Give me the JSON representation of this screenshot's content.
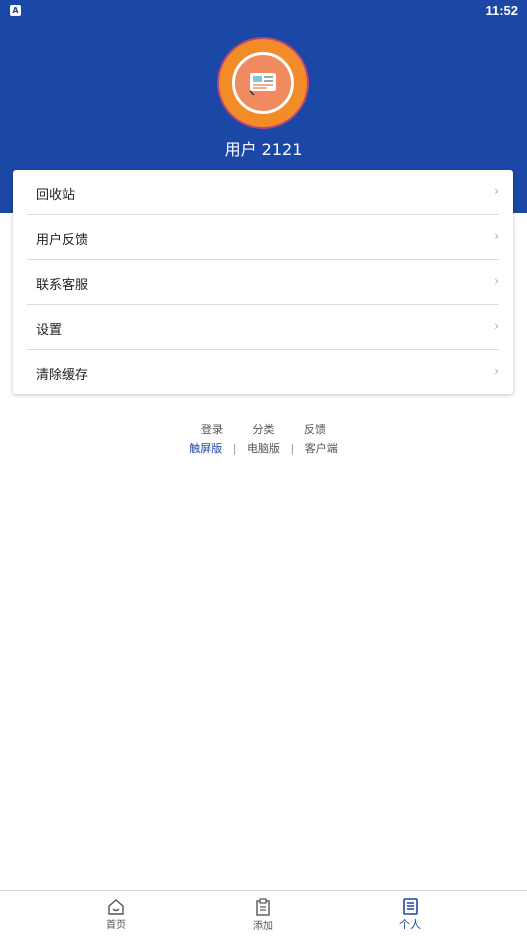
{
  "status_bar": {
    "app_icon_letter": "A",
    "time": "11:52"
  },
  "profile": {
    "username": "用户 2121"
  },
  "menu": {
    "items": [
      {
        "label": "回收站"
      },
      {
        "label": "用户反馈"
      },
      {
        "label": "联系客服"
      },
      {
        "label": "设置"
      },
      {
        "label": "清除缓存"
      }
    ],
    "chevron": "›"
  },
  "footer": {
    "links": [
      "登录",
      "分类",
      "反馈"
    ],
    "modes": [
      "触屏版",
      "电脑版",
      "客户端"
    ],
    "separator": "|"
  },
  "tabbar": {
    "tabs": [
      {
        "label": "首页",
        "icon": "home-icon"
      },
      {
        "label": "添加",
        "icon": "add-icon"
      },
      {
        "label": "个人",
        "icon": "profile-icon"
      }
    ]
  },
  "colors": {
    "header": "#1b47a6",
    "avatar_ring": "#f28c28",
    "active_tab": "#1b47a6"
  }
}
